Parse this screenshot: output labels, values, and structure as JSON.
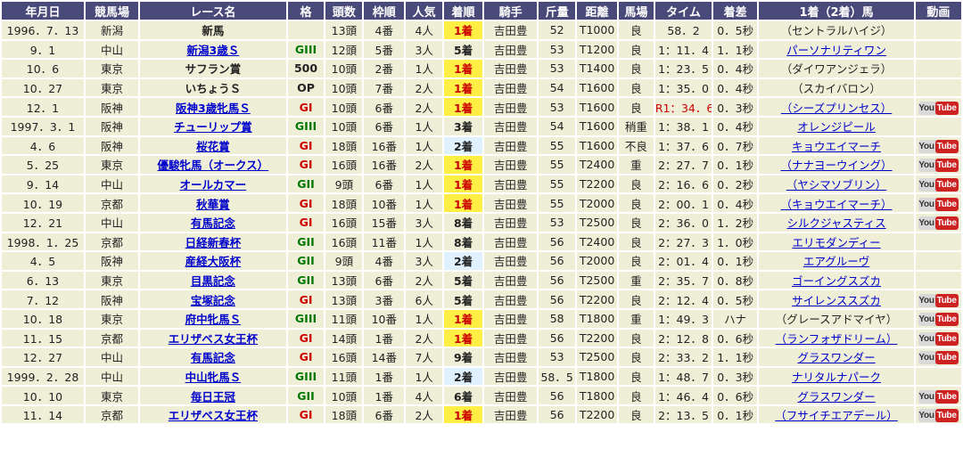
{
  "headers": [
    "年月日",
    "競馬場",
    "レース名",
    "格",
    "頭数",
    "枠順",
    "人気",
    "着順",
    "騎手",
    "斤量",
    "距離",
    "馬場",
    "タイム",
    "着差",
    "1着（2着）馬",
    "動画"
  ],
  "video_label": {
    "you": "You",
    "tube": "Tube"
  },
  "rows": [
    {
      "date": "1996．7．13",
      "track": "新潟",
      "race": "新馬",
      "race_link": false,
      "grade": "",
      "grade_class": "",
      "heads": "13頭",
      "gate": "4番",
      "pop": "4人",
      "place": "1着",
      "place_class": "place1",
      "jockey": "吉田豊",
      "weight": "52",
      "dist": "T1000",
      "cond": "良",
      "time": "58．2",
      "record": false,
      "margin": "0．5秒",
      "winner": "（セントラルハイジ）",
      "winner_link": false,
      "video": false
    },
    {
      "date": "9．1",
      "track": "中山",
      "race": "新潟3歳Ｓ",
      "race_link": true,
      "grade": "GIII",
      "grade_class": "g3",
      "heads": "12頭",
      "gate": "5番",
      "pop": "3人",
      "place": "5着",
      "place_class": "placeX",
      "jockey": "吉田豊",
      "weight": "53",
      "dist": "T1200",
      "cond": "良",
      "time": "1：11．4",
      "record": false,
      "margin": "1．1秒",
      "winner": "パーソナリティワン",
      "winner_link": true,
      "video": false
    },
    {
      "date": "10．6",
      "track": "東京",
      "race": "サフラン賞",
      "race_link": false,
      "grade": "500",
      "grade_class": "op",
      "heads": "10頭",
      "gate": "2番",
      "pop": "1人",
      "place": "1着",
      "place_class": "place1",
      "jockey": "吉田豊",
      "weight": "53",
      "dist": "T1400",
      "cond": "良",
      "time": "1：23．5",
      "record": false,
      "margin": "0．4秒",
      "winner": "（ダイワアンジェラ）",
      "winner_link": false,
      "video": false
    },
    {
      "date": "10．27",
      "track": "東京",
      "race": "いちょうＳ",
      "race_link": false,
      "grade": "OP",
      "grade_class": "op",
      "heads": "10頭",
      "gate": "7番",
      "pop": "2人",
      "place": "1着",
      "place_class": "place1",
      "jockey": "吉田豊",
      "weight": "54",
      "dist": "T1600",
      "cond": "良",
      "time": "1：35．0",
      "record": false,
      "margin": "0．4秒",
      "winner": "（スカイバロン）",
      "winner_link": false,
      "video": false
    },
    {
      "date": "12．1",
      "track": "阪神",
      "race": "阪神3歳牝馬Ｓ",
      "race_link": true,
      "grade": "GI",
      "grade_class": "g1",
      "heads": "10頭",
      "gate": "6番",
      "pop": "2人",
      "place": "1着",
      "place_class": "place1",
      "jockey": "吉田豊",
      "weight": "53",
      "dist": "T1600",
      "cond": "良",
      "time": "R1：34．6",
      "record": true,
      "margin": "0．3秒",
      "winner": "（シーズプリンセス）",
      "winner_link": true,
      "video": true
    },
    {
      "date": "1997．3．1",
      "track": "阪神",
      "race": "チューリップ賞",
      "race_link": true,
      "grade": "GIII",
      "grade_class": "g3",
      "heads": "10頭",
      "gate": "6番",
      "pop": "1人",
      "place": "3着",
      "place_class": "placeX",
      "jockey": "吉田豊",
      "weight": "54",
      "dist": "T1600",
      "cond": "稍重",
      "time": "1：38．1",
      "record": false,
      "margin": "0．4秒",
      "winner": "オレンジピール",
      "winner_link": true,
      "video": false
    },
    {
      "date": "4．6",
      "track": "阪神",
      "race": "桜花賞",
      "race_link": true,
      "grade": "GI",
      "grade_class": "g1",
      "heads": "18頭",
      "gate": "16番",
      "pop": "1人",
      "place": "2着",
      "place_class": "place2",
      "jockey": "吉田豊",
      "weight": "55",
      "dist": "T1600",
      "cond": "不良",
      "time": "1：37．6",
      "record": false,
      "margin": "0．7秒",
      "winner": "キョウエイマーチ",
      "winner_link": true,
      "video": true
    },
    {
      "date": "5．25",
      "track": "東京",
      "race": "優駿牝馬（オークス）",
      "race_link": true,
      "grade": "GI",
      "grade_class": "g1",
      "heads": "16頭",
      "gate": "16番",
      "pop": "2人",
      "place": "1着",
      "place_class": "place1",
      "jockey": "吉田豊",
      "weight": "55",
      "dist": "T2400",
      "cond": "重",
      "time": "2：27．7",
      "record": false,
      "margin": "0．1秒",
      "winner": "（ナナヨーウイング）",
      "winner_link": true,
      "video": true
    },
    {
      "date": "9．14",
      "track": "中山",
      "race": "オールカマー",
      "race_link": true,
      "grade": "GII",
      "grade_class": "g2",
      "heads": "9頭",
      "gate": "6番",
      "pop": "1人",
      "place": "1着",
      "place_class": "place1",
      "jockey": "吉田豊",
      "weight": "55",
      "dist": "T2200",
      "cond": "良",
      "time": "2：16．6",
      "record": false,
      "margin": "0．2秒",
      "winner": "（ヤシマソブリン）",
      "winner_link": true,
      "video": true
    },
    {
      "date": "10．19",
      "track": "京都",
      "race": "秋華賞",
      "race_link": true,
      "grade": "GI",
      "grade_class": "g1",
      "heads": "18頭",
      "gate": "10番",
      "pop": "1人",
      "place": "1着",
      "place_class": "place1",
      "jockey": "吉田豊",
      "weight": "55",
      "dist": "T2000",
      "cond": "良",
      "time": "2：00．1",
      "record": false,
      "margin": "0．4秒",
      "winner": "（キョウエイマーチ）",
      "winner_link": true,
      "video": true
    },
    {
      "date": "12．21",
      "track": "中山",
      "race": "有馬記念",
      "race_link": true,
      "grade": "GI",
      "grade_class": "g1",
      "heads": "16頭",
      "gate": "15番",
      "pop": "3人",
      "place": "8着",
      "place_class": "placeX",
      "jockey": "吉田豊",
      "weight": "53",
      "dist": "T2500",
      "cond": "良",
      "time": "2：36．0",
      "record": false,
      "margin": "1．2秒",
      "winner": "シルクジャスティス",
      "winner_link": true,
      "video": true
    },
    {
      "date": "1998．1．25",
      "track": "京都",
      "race": "日経新春杯",
      "race_link": true,
      "grade": "GII",
      "grade_class": "g2",
      "heads": "16頭",
      "gate": "11番",
      "pop": "1人",
      "place": "8着",
      "place_class": "placeX",
      "jockey": "吉田豊",
      "weight": "56",
      "dist": "T2400",
      "cond": "良",
      "time": "2：27．3",
      "record": false,
      "margin": "1．0秒",
      "winner": "エリモダンディー",
      "winner_link": true,
      "video": false
    },
    {
      "date": "4．5",
      "track": "阪神",
      "race": "産経大阪杯",
      "race_link": true,
      "grade": "GII",
      "grade_class": "g2",
      "heads": "9頭",
      "gate": "4番",
      "pop": "3人",
      "place": "2着",
      "place_class": "place2",
      "jockey": "吉田豊",
      "weight": "56",
      "dist": "T2000",
      "cond": "良",
      "time": "2：01．4",
      "record": false,
      "margin": "0．1秒",
      "winner": "エアグルーヴ",
      "winner_link": true,
      "video": false
    },
    {
      "date": "6．13",
      "track": "東京",
      "race": "目黒記念",
      "race_link": true,
      "grade": "GII",
      "grade_class": "g2",
      "heads": "13頭",
      "gate": "6番",
      "pop": "2人",
      "place": "5着",
      "place_class": "placeX",
      "jockey": "吉田豊",
      "weight": "56",
      "dist": "T2500",
      "cond": "重",
      "time": "2：35．7",
      "record": false,
      "margin": "0．8秒",
      "winner": "ゴーイングスズカ",
      "winner_link": true,
      "video": false
    },
    {
      "date": "7．12",
      "track": "阪神",
      "race": "宝塚記念",
      "race_link": true,
      "grade": "GI",
      "grade_class": "g1",
      "heads": "13頭",
      "gate": "3番",
      "pop": "6人",
      "place": "5着",
      "place_class": "placeX",
      "jockey": "吉田豊",
      "weight": "56",
      "dist": "T2200",
      "cond": "良",
      "time": "2：12．4",
      "record": false,
      "margin": "0．5秒",
      "winner": "サイレンススズカ",
      "winner_link": true,
      "video": true
    },
    {
      "date": "10．18",
      "track": "東京",
      "race": "府中牝馬Ｓ",
      "race_link": true,
      "grade": "GIII",
      "grade_class": "g3",
      "heads": "11頭",
      "gate": "10番",
      "pop": "1人",
      "place": "1着",
      "place_class": "place1",
      "jockey": "吉田豊",
      "weight": "58",
      "dist": "T1800",
      "cond": "重",
      "time": "1：49．3",
      "record": false,
      "margin": "ハナ",
      "winner": "（グレースアドマイヤ）",
      "winner_link": false,
      "video": true
    },
    {
      "date": "11．15",
      "track": "京都",
      "race": "エリザベス女王杯",
      "race_link": true,
      "grade": "GI",
      "grade_class": "g1",
      "heads": "14頭",
      "gate": "1番",
      "pop": "2人",
      "place": "1着",
      "place_class": "place1",
      "jockey": "吉田豊",
      "weight": "56",
      "dist": "T2200",
      "cond": "良",
      "time": "2：12．8",
      "record": false,
      "margin": "0．6秒",
      "winner": "（ランフォザドリーム）",
      "winner_link": true,
      "video": true
    },
    {
      "date": "12．27",
      "track": "中山",
      "race": "有馬記念",
      "race_link": true,
      "grade": "GI",
      "grade_class": "g1",
      "heads": "16頭",
      "gate": "14番",
      "pop": "7人",
      "place": "9着",
      "place_class": "placeX",
      "jockey": "吉田豊",
      "weight": "53",
      "dist": "T2500",
      "cond": "良",
      "time": "2：33．2",
      "record": false,
      "margin": "1．1秒",
      "winner": "グラスワンダー",
      "winner_link": true,
      "video": true
    },
    {
      "date": "1999．2．28",
      "track": "中山",
      "race": "中山牝馬Ｓ",
      "race_link": true,
      "grade": "GIII",
      "grade_class": "g3",
      "heads": "11頭",
      "gate": "1番",
      "pop": "1人",
      "place": "2着",
      "place_class": "place2",
      "jockey": "吉田豊",
      "weight": "58．5",
      "dist": "T1800",
      "cond": "良",
      "time": "1：48．7",
      "record": false,
      "margin": "0．3秒",
      "winner": "ナリタルナパーク",
      "winner_link": true,
      "video": false
    },
    {
      "date": "10．10",
      "track": "東京",
      "race": "毎日王冠",
      "race_link": true,
      "grade": "GII",
      "grade_class": "g2",
      "heads": "10頭",
      "gate": "1番",
      "pop": "4人",
      "place": "6着",
      "place_class": "placeX",
      "jockey": "吉田豊",
      "weight": "56",
      "dist": "T1800",
      "cond": "良",
      "time": "1：46．4",
      "record": false,
      "margin": "0．6秒",
      "winner": "グラスワンダー",
      "winner_link": true,
      "video": true
    },
    {
      "date": "11．14",
      "track": "京都",
      "race": "エリザベス女王杯",
      "race_link": true,
      "grade": "GI",
      "grade_class": "g1",
      "heads": "18頭",
      "gate": "6番",
      "pop": "2人",
      "place": "1着",
      "place_class": "place1",
      "jockey": "吉田豊",
      "weight": "56",
      "dist": "T2200",
      "cond": "良",
      "time": "2：13．5",
      "record": false,
      "margin": "0．1秒",
      "winner": "（フサイチエアデール）",
      "winner_link": true,
      "video": true
    }
  ]
}
